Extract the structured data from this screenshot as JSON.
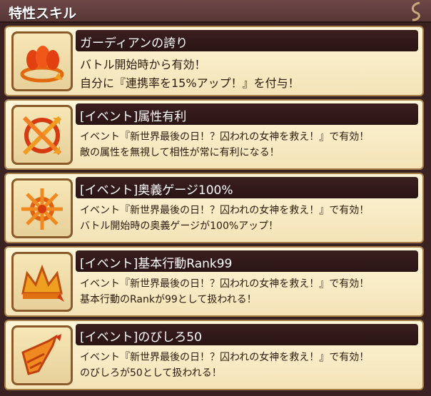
{
  "header": {
    "title": "特性スキル"
  },
  "skills": [
    {
      "name": "ガーディアンの誇り",
      "lines": [
        "バトル開始時から有効！",
        "自分に『連携率を15%アップ！』を付与！"
      ],
      "icon": "flames-rise-icon"
    },
    {
      "name": "[イベント]属性有利",
      "lines": [
        "イベント『新世界最後の日！？囚われの女神を救え！』で有効！",
        "敵の属性を無視して相性が常に有利になる！"
      ],
      "icon": "crossed-arrows-icon"
    },
    {
      "name": "[イベント]奥義ゲージ100%",
      "lines": [
        "イベント『新世界最後の日！？囚われの女神を救え！』で有効！",
        "バトル開始時の奥義ゲージが100%アップ！"
      ],
      "icon": "star-burst-icon"
    },
    {
      "name": "[イベント]基本行動Rank99",
      "lines": [
        "イベント『新世界最後の日！？囚われの女神を救え！』で有効！",
        "基本行動のRankが99として扱われる！"
      ],
      "icon": "crown-icon"
    },
    {
      "name": "[イベント]のびしろ50",
      "lines": [
        "イベント『新世界最後の日！？囚われの女神を救え！』で有効！",
        "のびしろが50として扱われる！"
      ],
      "icon": "drill-arrow-icon"
    }
  ]
}
